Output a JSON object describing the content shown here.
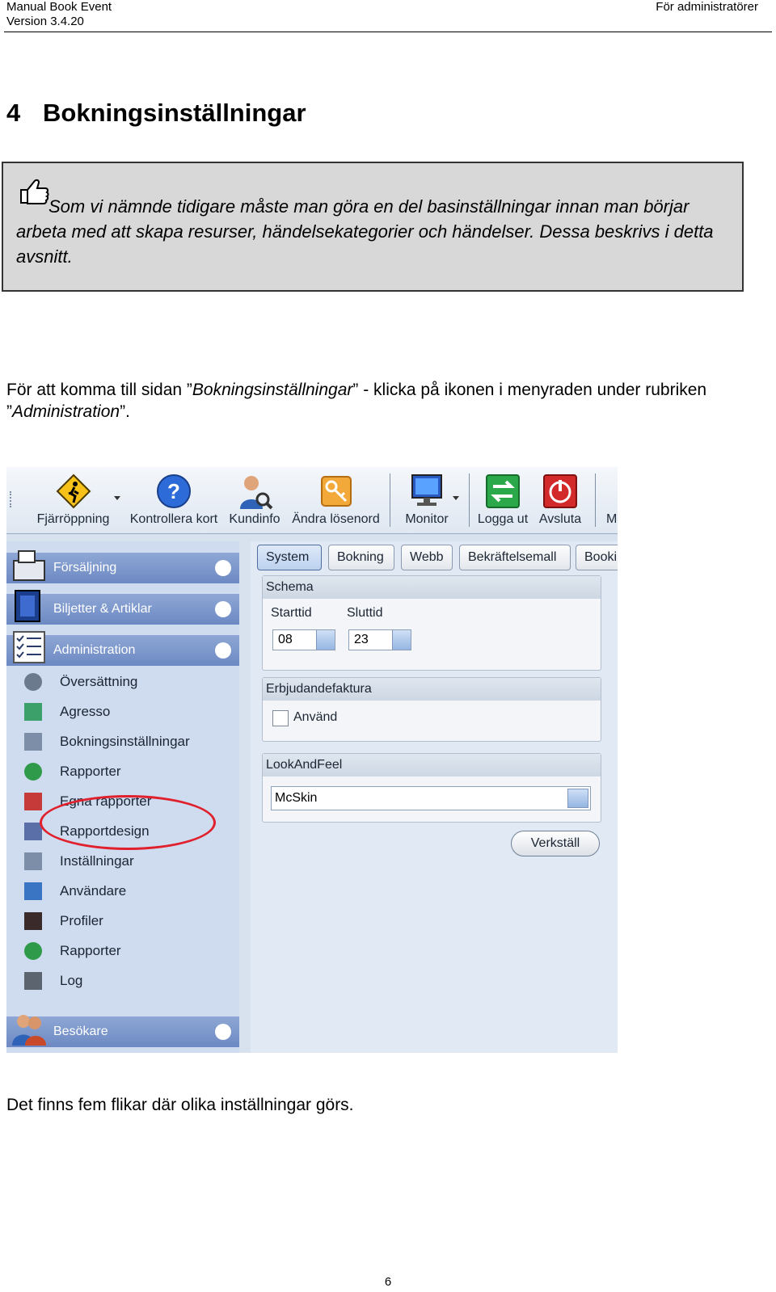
{
  "header": {
    "title": "Manual Book Event",
    "version": "Version 3.4.20",
    "audience": "För administratörer"
  },
  "section": {
    "number": "4",
    "title": "Bokningsinställningar"
  },
  "note": {
    "icon": "thumbs-up-icon",
    "text": "Som vi nämnde tidigare måste man göra en del basinställningar innan man börjar arbeta med att skapa resurser, händelsekategorier och händelser. Dessa beskrivs i detta avsnitt."
  },
  "intro": {
    "part1": "För att komma till sidan ”",
    "link1": "Bokningsinställningar",
    "part2": "” - klicka på ikonen i menyraden under rubriken ”",
    "link2": "Administration",
    "part3": "”."
  },
  "screenshot": {
    "toolbar": [
      {
        "label": "Fjärröppning",
        "icon": "warning-pedestrian-icon"
      },
      {
        "label": "Kontrollera kort",
        "icon": "help-question-icon"
      },
      {
        "label": "Kundinfo",
        "icon": "user-search-icon"
      },
      {
        "label": "Ändra lösenord",
        "icon": "key-icon"
      },
      {
        "label": "Monitor",
        "icon": "monitor-icon"
      },
      {
        "label": "Logga ut",
        "icon": "logout-arrows-icon"
      },
      {
        "label": "Avsluta",
        "icon": "power-icon"
      },
      {
        "label": "M",
        "icon": "more-icon"
      }
    ],
    "sidebar": {
      "categories": [
        {
          "label": "Försäljning",
          "icon": "cash-register-icon"
        },
        {
          "label": "Biljetter & Artiklar",
          "icon": "tickets-icon"
        },
        {
          "label": "Administration",
          "icon": "checklist-icon"
        },
        {
          "label": "Besökare",
          "icon": "visitors-icon"
        }
      ],
      "items": [
        {
          "label": "Översättning",
          "icon": "translate-icon"
        },
        {
          "label": "Agresso",
          "icon": "agresso-icon"
        },
        {
          "label": "Bokningsinställningar",
          "icon": "tools-icon"
        },
        {
          "label": "Rapporter",
          "icon": "pin-icon"
        },
        {
          "label": "Egna rapporter",
          "icon": "calendar-report-icon"
        },
        {
          "label": "Rapportdesign",
          "icon": "design-pencil-icon"
        },
        {
          "label": "Inställningar",
          "icon": "settings-tools-icon"
        },
        {
          "label": "Användare",
          "icon": "user-card-icon"
        },
        {
          "label": "Profiler",
          "icon": "profile-icon"
        },
        {
          "label": "Rapporter",
          "icon": "pin-icon"
        },
        {
          "label": "Log",
          "icon": "printer-log-icon"
        }
      ]
    },
    "tabs": [
      "System",
      "Bokning",
      "Webb",
      "Bekräftelsemall",
      "Booki"
    ],
    "schema": {
      "title": "Schema",
      "start_label": "Starttid",
      "start_value": "08",
      "end_label": "Sluttid",
      "end_value": "23"
    },
    "offer": {
      "title": "Erbjudandefaktura",
      "checkbox_label": "Använd"
    },
    "look": {
      "title": "LookAndFeel",
      "selected": "McSkin"
    },
    "apply_button": "Verkställ"
  },
  "outro": "Det finns fem flikar där olika inställningar görs.",
  "page_number": "6"
}
